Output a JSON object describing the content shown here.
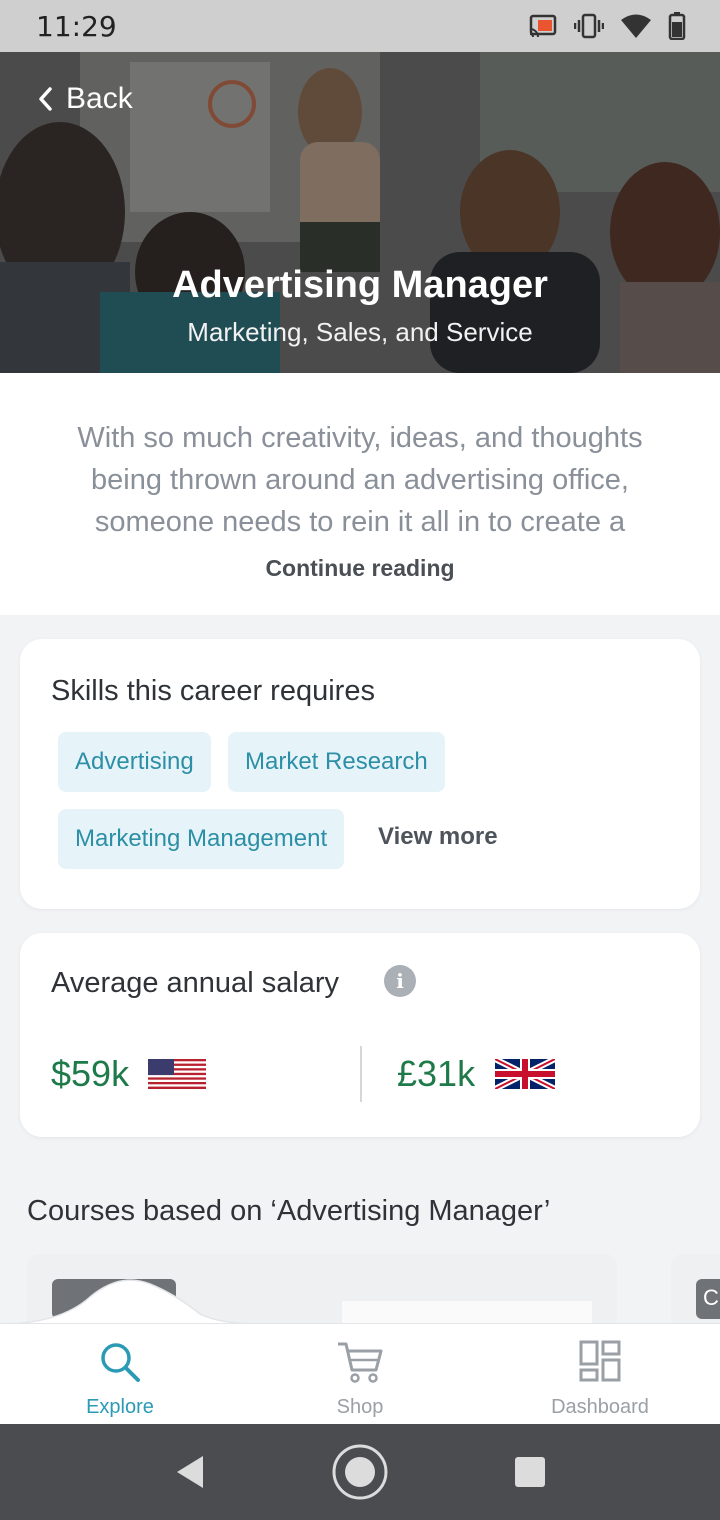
{
  "status_bar": {
    "time": "11:29",
    "icons": [
      "cast-icon",
      "vibrate-icon",
      "wifi-icon",
      "battery-icon"
    ]
  },
  "header": {
    "back_label": "Back",
    "title": "Advertising Manager",
    "subtitle": "Marketing, Sales, and Service"
  },
  "description": {
    "text": "With so much creativity, ideas, and thoughts being thrown around an advertising office, someone needs to rein it all in to create a",
    "continue_label": "Continue reading"
  },
  "skills": {
    "heading": "Skills this career requires",
    "items": [
      {
        "label": "Advertising"
      },
      {
        "label": "Market Research"
      },
      {
        "label": "Marketing Management"
      }
    ],
    "view_more_label": "View more"
  },
  "salary": {
    "heading": "Average annual salary",
    "us_value": "$59k",
    "uk_value": "£31k"
  },
  "courses": {
    "heading": "Courses based on ‘Advertising Manager’",
    "badge_second": "C"
  },
  "bottom_nav": {
    "items": [
      {
        "label": "Explore",
        "icon": "search-icon",
        "active": true
      },
      {
        "label": "Shop",
        "icon": "cart-icon",
        "active": false
      },
      {
        "label": "Dashboard",
        "icon": "dashboard-icon",
        "active": false
      }
    ]
  },
  "colors": {
    "accent": "#2b9bb5",
    "chip_bg": "#e6f4fa",
    "salary_green": "#1f7a4a"
  }
}
